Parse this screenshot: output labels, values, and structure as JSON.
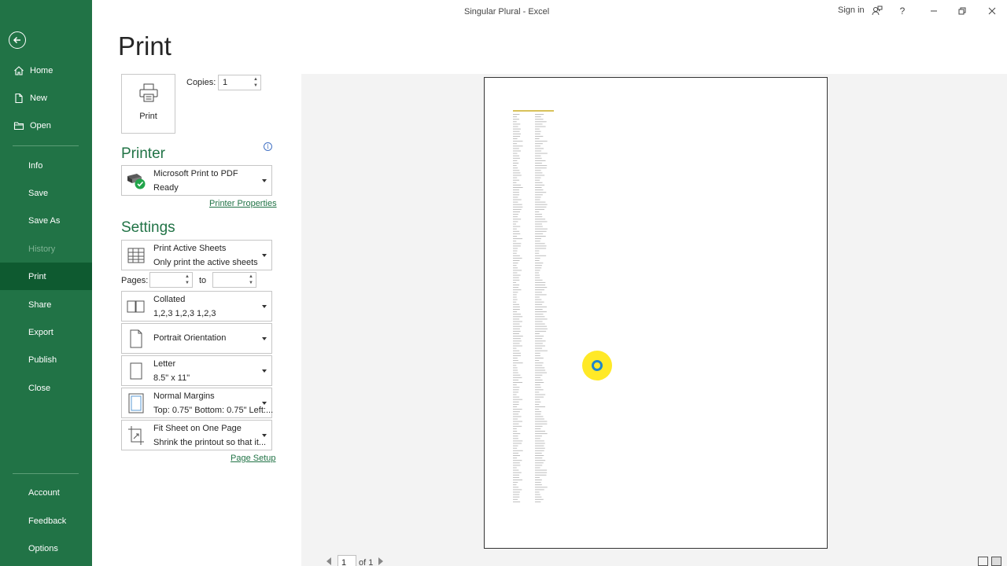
{
  "window": {
    "title": "Singular Plural  -  Excel",
    "sign_in": "Sign in"
  },
  "sidebar": {
    "items": [
      {
        "label": "Home",
        "icon": "home-icon"
      },
      {
        "label": "New",
        "icon": "new-document-icon"
      },
      {
        "label": "Open",
        "icon": "folder-open-icon"
      },
      {
        "label": "Info"
      },
      {
        "label": "Save"
      },
      {
        "label": "Save As"
      },
      {
        "label": "History"
      },
      {
        "label": "Print"
      },
      {
        "label": "Share"
      },
      {
        "label": "Export"
      },
      {
        "label": "Publish"
      },
      {
        "label": "Close"
      }
    ],
    "bottom": [
      {
        "label": "Account"
      },
      {
        "label": "Feedback"
      },
      {
        "label": "Options"
      }
    ]
  },
  "print": {
    "heading": "Print",
    "button_label": "Print",
    "copies_label": "Copies:",
    "copies_value": "1"
  },
  "printer": {
    "heading": "Printer",
    "name": "Microsoft Print to PDF",
    "status": "Ready",
    "properties_link": "Printer Properties"
  },
  "settings": {
    "heading": "Settings",
    "what": {
      "line1": "Print Active Sheets",
      "line2": "Only print the active sheets"
    },
    "pages_label": "Pages:",
    "pages_from": "",
    "pages_to_label": "to",
    "pages_to": "",
    "collation": {
      "line1": "Collated",
      "line2": "1,2,3    1,2,3    1,2,3"
    },
    "orientation": {
      "line1": "Portrait Orientation"
    },
    "paper": {
      "line1": "Letter",
      "line2": "8.5\" x 11\""
    },
    "margins": {
      "line1": "Normal Margins",
      "line2": "Top: 0.75\" Bottom: 0.75\" Left:..."
    },
    "scaling": {
      "line1": "Fit Sheet on One Page",
      "line2": "Shrink the printout so that it..."
    },
    "page_setup_link": "Page Setup"
  },
  "preview": {
    "current_page": "1",
    "of_pages": "of 1"
  },
  "colors": {
    "accent": "#217346",
    "accent_dark": "#0e5a30"
  }
}
